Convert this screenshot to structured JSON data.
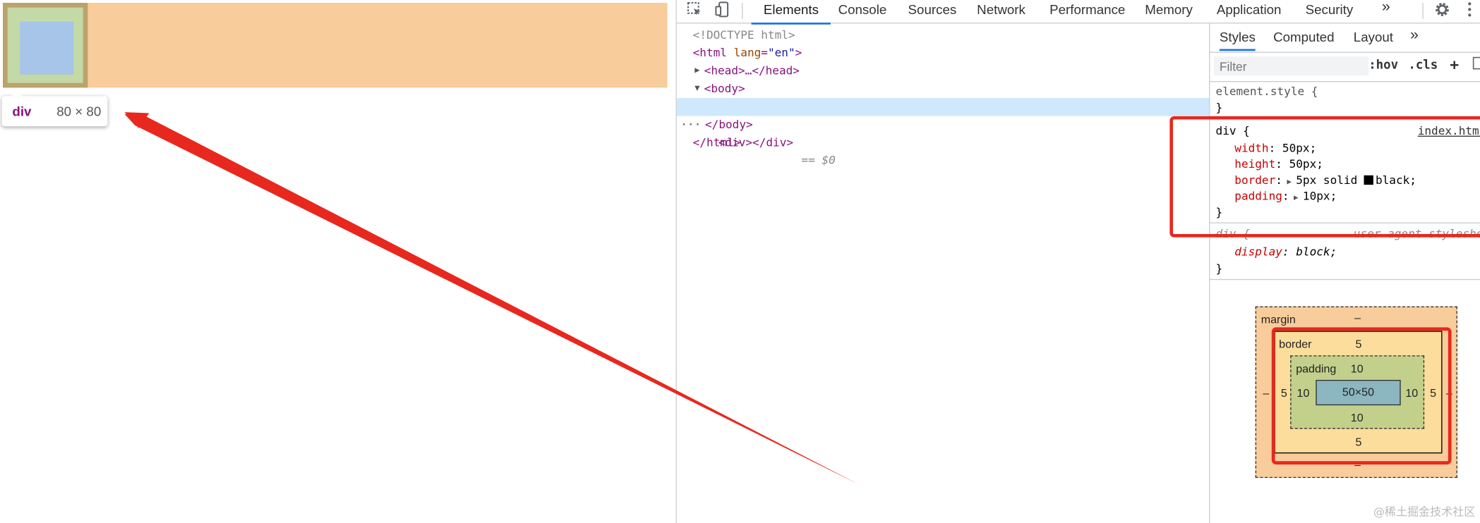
{
  "inspector_tooltip": {
    "tag": "div",
    "size": "80 × 80"
  },
  "devtools": {
    "tabs": [
      "Elements",
      "Console",
      "Sources",
      "Network",
      "Performance",
      "Memory",
      "Application",
      "Security"
    ],
    "more": "»",
    "dom": {
      "doctype": "<!DOCTYPE html>",
      "html_open_tag": "html",
      "html_attr": "lang",
      "html_attr_value": "\"en\"",
      "head": "<head>…</head>",
      "body_open": "<body>",
      "selected_div": "<div></div>",
      "selected_marker": "== $0",
      "dots": "···",
      "body_close": "</body>",
      "html_close": "</html>"
    },
    "styles": {
      "tabs": [
        "Styles",
        "Computed",
        "Layout"
      ],
      "more": "»",
      "filter_placeholder": "Filter",
      "hov": ":hov",
      "cls": ".cls",
      "element_style": "element.style {",
      "close_brace": "}",
      "div_selector": "div {",
      "source": "index.html",
      "decls": [
        {
          "prop": "width",
          "value": "50px;"
        },
        {
          "prop": "height",
          "value": "50px;"
        },
        {
          "prop": "border",
          "value": "5px solid",
          "color": "black;"
        },
        {
          "prop": "padding",
          "value": "10px;"
        }
      ],
      "ua_selector": "div {",
      "ua_source": "user agent stylesheet",
      "ua_prop": "display",
      "ua_value": "block;"
    },
    "box_model": {
      "margin_label": "margin",
      "margin_top": "–",
      "margin_bottom": "–",
      "margin_left": "–",
      "margin_right": "–",
      "border_label": "border",
      "border_top": "5",
      "border_bottom": "5",
      "border_left": "5",
      "border_right": "5",
      "padding_label": "padding",
      "padding_top": "10",
      "padding_bottom": "10",
      "padding_left": "10",
      "padding_right": "10",
      "content": "50×50"
    }
  },
  "watermark": "@稀土掘金技术社区",
  "colors": {
    "highlight": "#e8281e",
    "accent": "#1a73e8"
  }
}
